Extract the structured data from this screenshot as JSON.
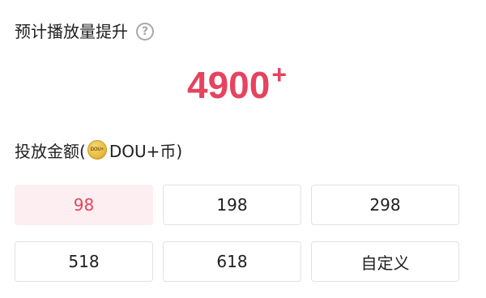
{
  "title": "预计播放量提升",
  "help_icon": "question-circle-icon",
  "estimate": {
    "value": "4900",
    "suffix": "+",
    "color": "#e6435e"
  },
  "amount_label": {
    "prefix": "投放金额(",
    "coin_icon": "dou-coin-icon",
    "coin_text": "DOU+",
    "currency": "DOU+币)"
  },
  "options": [
    {
      "label": "98",
      "selected": true
    },
    {
      "label": "198",
      "selected": false
    },
    {
      "label": "298",
      "selected": false
    },
    {
      "label": "518",
      "selected": false
    },
    {
      "label": "618",
      "selected": false
    },
    {
      "label": "自定义",
      "selected": false
    }
  ]
}
